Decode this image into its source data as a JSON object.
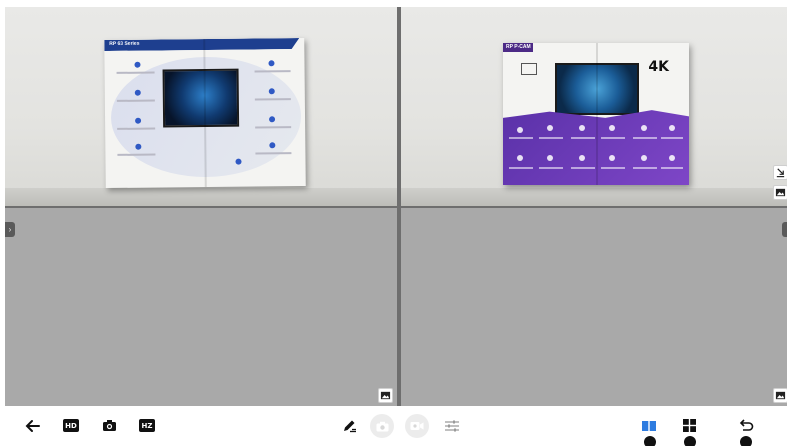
{
  "panes": {
    "brochure1_header": "RP 63 Series",
    "brochure2_header": "RP P-CAM",
    "brochure2_badge": "4K"
  },
  "toolbar": {
    "left": [
      {
        "name": "back-arrow-icon"
      },
      {
        "name": "hd-quality-button",
        "label": "HD"
      },
      {
        "name": "camera-button-icon"
      },
      {
        "name": "hz-button",
        "label": "HZ"
      }
    ],
    "center": [
      {
        "name": "annotate-pen-icon"
      },
      {
        "name": "snapshot-camera-icon"
      },
      {
        "name": "record-video-icon"
      },
      {
        "name": "adjust-sliders-icon"
      }
    ],
    "right": [
      {
        "name": "layout-two-split-icon"
      },
      {
        "name": "layout-four-split-icon"
      },
      {
        "name": "undo-return-icon"
      }
    ]
  },
  "colors": {
    "grid_gap": "#6e6e6e",
    "empty_pane": "#a9a9a9",
    "layout_active_blue": "#2e7ce0",
    "brochure_blue": "#1e3f8f",
    "brochure_purple": "#5a31a8"
  }
}
